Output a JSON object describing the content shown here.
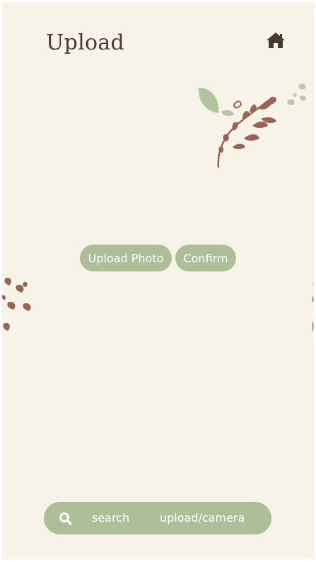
{
  "header": {
    "title": "Upload",
    "home_icon": "home-icon"
  },
  "actions": {
    "upload_label": "Upload Photo",
    "confirm_label": "Confirm"
  },
  "bottom_nav": {
    "search_icon": "search-icon",
    "search_label": "search",
    "upload_label": "upload/camera"
  },
  "colors": {
    "background": "#f8f3e9",
    "accent": "#adbf98",
    "leaf_brown": "#9a6452",
    "leaf_green": "#a9bf96",
    "text_dark": "#4a3a32"
  }
}
